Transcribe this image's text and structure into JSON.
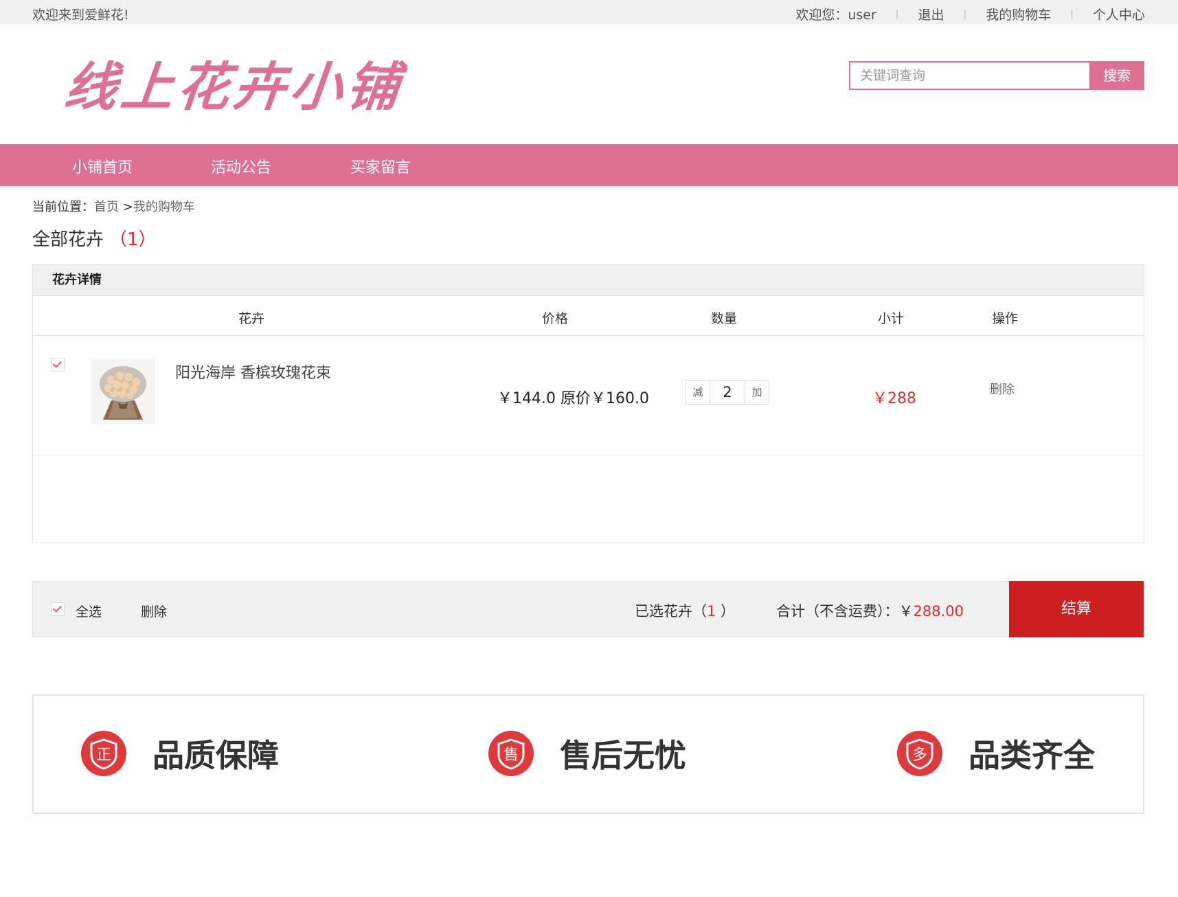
{
  "topbar": {
    "welcome": "欢迎来到爱鲜花!",
    "greeting": "欢迎您：user",
    "logout": "退出",
    "cart": "我的购物车",
    "profile": "个人中心"
  },
  "logo": {
    "text": "线上花卉小铺"
  },
  "search": {
    "placeholder": "关键词查询",
    "button": "搜索"
  },
  "nav": {
    "items": [
      "小铺首页",
      "活动公告",
      "买家留言"
    ]
  },
  "breadcrumb": {
    "label": "当前位置：",
    "home": "首页",
    "separator": ">",
    "current": "我的购物车"
  },
  "section": {
    "title": "全部花卉",
    "count": "（1）"
  },
  "cart": {
    "header": "花卉详情",
    "columns": [
      "花卉",
      "价格",
      "数量",
      "小计",
      "操作"
    ],
    "items": [
      {
        "checked": true,
        "name": "阳光海岸 香槟玫瑰花束",
        "price": "￥144.0 原价￥160.0",
        "decrease": "减",
        "quantity": "2",
        "increase": "加",
        "subtotal": "￥288",
        "action": "删除"
      }
    ]
  },
  "footer_bar": {
    "select_all": "全选",
    "delete": "删除",
    "selected_label": "已选花卉（",
    "selected_count": "1",
    "selected_close": " ）",
    "total_label": "合计（不含运费）：￥",
    "total_amount": "288.00",
    "checkout": "结算"
  },
  "guarantees": [
    {
      "icon": "quality-badge-icon",
      "glyph": "正",
      "text": "品质保障"
    },
    {
      "icon": "after-sales-badge-icon",
      "glyph": "售",
      "text": "售后无忧"
    },
    {
      "icon": "variety-badge-icon",
      "glyph": "多",
      "text": "品类齐全"
    }
  ],
  "colors": {
    "brand_pink": "#dd7093",
    "accent_red": "#cd1f22",
    "price_red": "#e02b2b"
  }
}
